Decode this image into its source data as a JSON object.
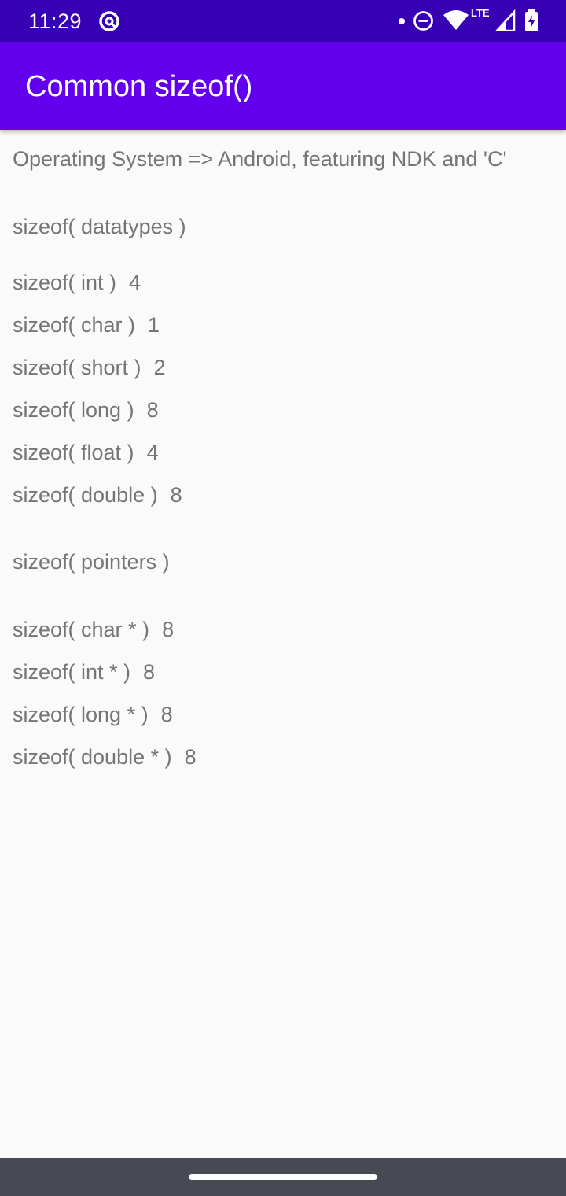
{
  "status_bar": {
    "time": "11:29",
    "network_label": "LTE",
    "icons": [
      "at-sign-icon",
      "notification-dot-icon",
      "do-not-disturb-icon",
      "wifi-icon",
      "cell-signal-icon",
      "battery-charging-icon"
    ]
  },
  "app_bar": {
    "title": "Common sizeof()",
    "color": "#6200ee",
    "status_color": "#3700b3"
  },
  "content": {
    "os_line": "Operating System => Android, featuring NDK and 'C'",
    "datatypes_header": "sizeof( datatypes )",
    "datatypes": [
      {
        "label": "sizeof( int )",
        "value": "4"
      },
      {
        "label": "sizeof( char )",
        "value": "1"
      },
      {
        "label": "sizeof( short )",
        "value": "2"
      },
      {
        "label": "sizeof( long )",
        "value": "8"
      },
      {
        "label": "sizeof( float )",
        "value": "4"
      },
      {
        "label": "sizeof( double )",
        "value": "8"
      }
    ],
    "pointers_header": "sizeof( pointers )",
    "pointers": [
      {
        "label": "sizeof( char * )",
        "value": "8"
      },
      {
        "label": "sizeof( int * )",
        "value": "8"
      },
      {
        "label": "sizeof( long * )",
        "value": "8"
      },
      {
        "label": "sizeof( double * )",
        "value": "8"
      }
    ]
  },
  "nav_bar": {
    "color": "#474a52"
  }
}
